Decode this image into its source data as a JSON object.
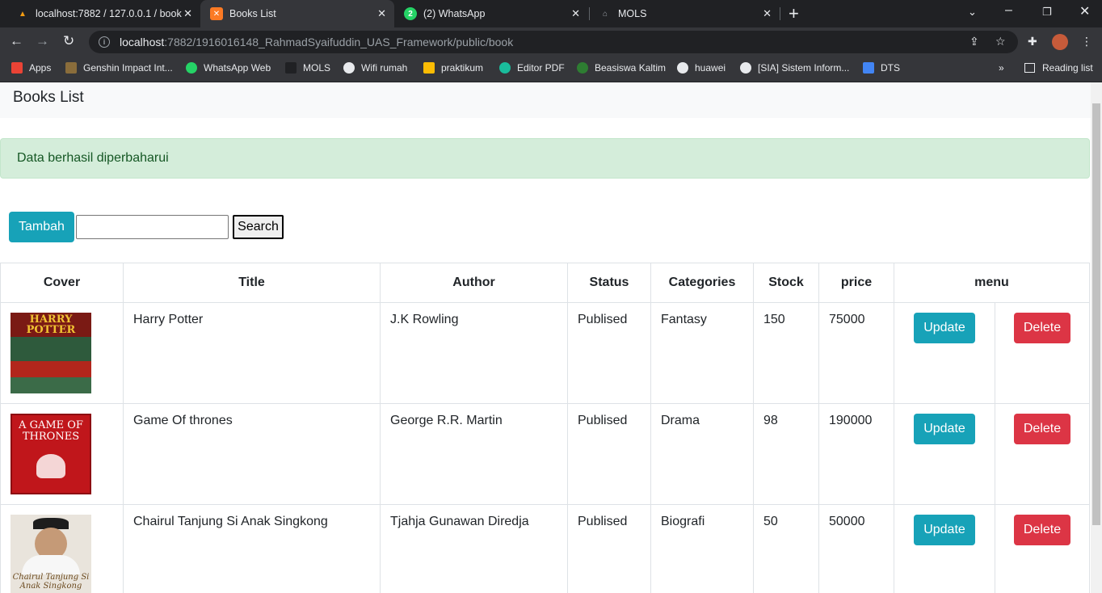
{
  "tabs": [
    {
      "title": "localhost:7882 / 127.0.0.1 / book",
      "favicon": "phpmyadmin-icon"
    },
    {
      "title": "Books List",
      "favicon": "xampp-icon"
    },
    {
      "title": "(2) WhatsApp",
      "favicon": "whatsapp-icon"
    },
    {
      "title": "MOLS",
      "favicon": "home-icon"
    }
  ],
  "address": {
    "host": "localhost",
    "path": ":7882/1916016148_RahmadSyaifuddin_UAS_Framework/public/book"
  },
  "bookmarks": [
    {
      "label": "Apps",
      "color": "#ea4335"
    },
    {
      "label": "Genshin Impact Int...",
      "color": "#8a6d3b"
    },
    {
      "label": "WhatsApp Web",
      "color": "#25d366"
    },
    {
      "label": "MOLS",
      "color": "#202124"
    },
    {
      "label": "Wifi rumah",
      "color": "#e8eaed"
    },
    {
      "label": "praktikum",
      "color": "#fbbc04"
    },
    {
      "label": "Editor PDF",
      "color": "#1abc9c"
    },
    {
      "label": "Beasiswa Kaltim",
      "color": "#2e7d32"
    },
    {
      "label": "huawei",
      "color": "#e8eaed"
    },
    {
      "label": "[SIA] Sistem Inform...",
      "color": "#e8eaed"
    },
    {
      "label": "DTS",
      "color": "#4285f4"
    }
  ],
  "reading_list": "Reading list",
  "brand": "Books List",
  "alert": "Data berhasil diperbaharui",
  "tambah": "Tambah",
  "search": {
    "button": "Search",
    "value": ""
  },
  "table": {
    "headers": [
      "Cover",
      "Title",
      "Author",
      "Status",
      "Categories",
      "Stock",
      "price",
      "menu"
    ],
    "update_label": "Update",
    "delete_label": "Delete",
    "rows": [
      {
        "title": "Harry Potter",
        "author": "J.K Rowling",
        "status": "Publised",
        "category": "Fantasy",
        "stock": "150",
        "price": "75000",
        "cover_text": "HARRY POTTER",
        "cover_color": "#2e5a3c"
      },
      {
        "title": "Game Of thrones",
        "author": "George R.R. Martin",
        "status": "Publised",
        "category": "Drama",
        "stock": "98",
        "price": "190000",
        "cover_text": "A GAME OF THRONES",
        "cover_color": "#c0161b"
      },
      {
        "title": "Chairul Tanjung Si Anak Singkong",
        "author": "Tjahja Gunawan Diredja",
        "status": "Publised",
        "category": "Biografi",
        "stock": "50",
        "price": "50000",
        "cover_text": "Chairul Tanjung Si Anak Singkong",
        "cover_color": "#e9e4dc"
      }
    ]
  }
}
